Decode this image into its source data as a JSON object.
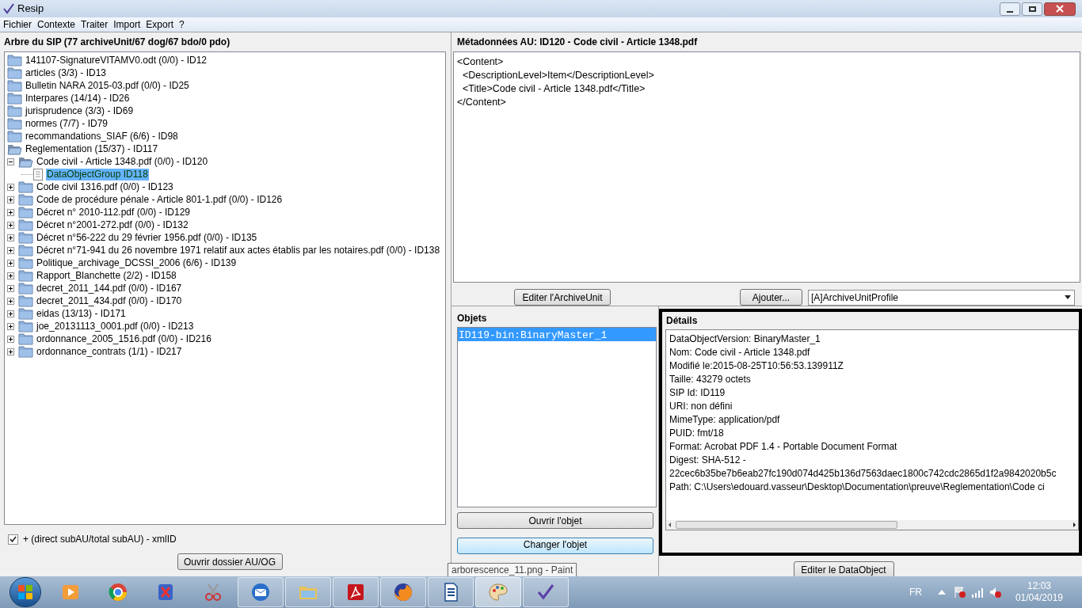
{
  "window": {
    "title": "Resip"
  },
  "menu": [
    "Fichier",
    "Contexte",
    "Traiter",
    "Import",
    "Export",
    "?"
  ],
  "tree_panel": {
    "title": "Arbre du SIP (77 archiveUnit/67 dog/67 bdo/0 pdo)",
    "items": [
      {
        "label": "141107-SignatureVITAMV0.odt (0/0) - ID12",
        "kind": "folder",
        "expanded": false,
        "selected": false
      },
      {
        "label": "articles (3/3) - ID13",
        "kind": "folder",
        "expanded": false,
        "selected": false
      },
      {
        "label": "Bulletin NARA 2015-03.pdf (0/0) - ID25",
        "kind": "folder",
        "expanded": false,
        "selected": false
      },
      {
        "label": "Interpares (14/14) - ID26",
        "kind": "folder",
        "expanded": false,
        "selected": false
      },
      {
        "label": "jurisprudence (3/3) - ID69",
        "kind": "folder",
        "expanded": false,
        "selected": false
      },
      {
        "label": "normes (7/7) - ID79",
        "kind": "folder",
        "expanded": false,
        "selected": false
      },
      {
        "label": "recommandations_SIAF (6/6) - ID98",
        "kind": "folder",
        "expanded": false,
        "selected": false
      },
      {
        "label": "Reglementation (15/37) - ID117",
        "kind": "folder",
        "expanded": true,
        "selected": false,
        "children": [
          {
            "label": "Code civil - Article 1348.pdf (0/0) - ID120",
            "kind": "folder",
            "expanded": true,
            "selected": false,
            "children": [
              {
                "label": "DataObjectGroup ID118",
                "kind": "object-group",
                "selected": true
              }
            ]
          },
          {
            "label": "Code civil 1316.pdf (0/0) - ID123",
            "kind": "folder",
            "expanded": false,
            "selected": false
          },
          {
            "label": "Code de procédure pénale - Article 801-1.pdf (0/0) - ID126",
            "kind": "folder",
            "expanded": false,
            "selected": false
          },
          {
            "label": "Décret n° 2010-112.pdf (0/0) - ID129",
            "kind": "folder",
            "expanded": false,
            "selected": false
          },
          {
            "label": "Décret n°2001-272.pdf (0/0) - ID132",
            "kind": "folder",
            "expanded": false,
            "selected": false
          },
          {
            "label": "Décret n°56-222 du 29 février 1956.pdf (0/0) - ID135",
            "kind": "folder",
            "expanded": false,
            "selected": false
          },
          {
            "label": "Décret n°71-941 du 26 novembre 1971 relatif aux actes établis par les notaires.pdf (0/0) - ID138",
            "kind": "folder",
            "expanded": false,
            "selected": false
          },
          {
            "label": "Politique_archivage_DCSSI_2006 (6/6) - ID139",
            "kind": "folder",
            "expanded": false,
            "selected": false
          },
          {
            "label": "Rapport_Blanchette (2/2) - ID158",
            "kind": "folder",
            "expanded": false,
            "selected": false
          },
          {
            "label": "decret_2011_144.pdf (0/0) - ID167",
            "kind": "folder",
            "expanded": false,
            "selected": false
          },
          {
            "label": "decret_2011_434.pdf (0/0) - ID170",
            "kind": "folder",
            "expanded": false,
            "selected": false
          },
          {
            "label": "eidas (13/13) - ID171",
            "kind": "folder",
            "expanded": false,
            "selected": false
          },
          {
            "label": "joe_20131113_0001.pdf (0/0) - ID213",
            "kind": "folder",
            "expanded": false,
            "selected": false
          },
          {
            "label": "ordonnance_2005_1516.pdf (0/0) - ID216",
            "kind": "folder",
            "expanded": false,
            "selected": false
          },
          {
            "label": "ordonnance_contrats (1/1) - ID217",
            "kind": "folder",
            "expanded": false,
            "selected": false
          }
        ]
      }
    ],
    "option": {
      "label": "+ (direct subAU/total subAU) - xmlID",
      "checked": true
    },
    "button": "Ouvrir dossier AU/OG"
  },
  "metadata_panel": {
    "title": "Métadonnées AU: ID120 - Code civil - Article 1348.pdf",
    "content": [
      "<Content>",
      "  <DescriptionLevel>Item</DescriptionLevel>",
      "  <Title>Code civil - Article 1348.pdf</Title>",
      "</Content>"
    ],
    "buttons": [
      "Editer l'ArchiveUnit",
      "Ajouter..."
    ],
    "profile_select": "[A]ArchiveUnitProfile"
  },
  "objects_panel": {
    "title": "Objets",
    "items": [
      {
        "label": "ID119-bin:BinaryMaster_1",
        "selected": true
      }
    ],
    "buttons": [
      "Ouvrir l'objet",
      "Changer l'objet"
    ]
  },
  "details_panel": {
    "title": "Détails",
    "lines": [
      "DataObjectVersion: BinaryMaster_1",
      "Nom: Code civil - Article 1348.pdf",
      "Modifié le:2015-08-25T10:56:53.139911Z",
      "Taille: 43279 octets",
      "SIP Id: ID119",
      "URI: non défini",
      "MimeType: application/pdf",
      "PUID: fmt/18",
      "Format: Acrobat PDF 1.4 - Portable Document Format",
      "Digest: SHA-512 -",
      "22cec6b35be7b6eab27fc190d074d425b136d7563daec1800c742cdc2865d1f2a9842020b5c",
      "Path: C:\\Users\\edouard.vasseur\\Desktop\\Documentation\\preuve\\Reglementation\\Code ci"
    ],
    "button": "Editer le DataObject"
  },
  "tooltip": "arborescence_11.png - Paint",
  "taskbar": {
    "apps": [
      {
        "kind": "media",
        "running": false,
        "selected": false
      },
      {
        "kind": "round-browser",
        "running": false,
        "selected": false
      },
      {
        "kind": "x-app",
        "running": false,
        "selected": false
      },
      {
        "kind": "scissors",
        "running": false,
        "selected": false
      },
      {
        "kind": "mail",
        "running": true,
        "selected": false
      },
      {
        "kind": "folder",
        "running": true,
        "selected": false
      },
      {
        "kind": "pdf",
        "running": true,
        "selected": false
      },
      {
        "kind": "fox",
        "running": true,
        "selected": false
      },
      {
        "kind": "document",
        "running": true,
        "selected": false
      },
      {
        "kind": "palette",
        "running": true,
        "selected": true
      },
      {
        "kind": "checkmark",
        "running": true,
        "selected": false
      }
    ],
    "language": "FR",
    "time": "12:03",
    "date": "01/04/2019"
  }
}
